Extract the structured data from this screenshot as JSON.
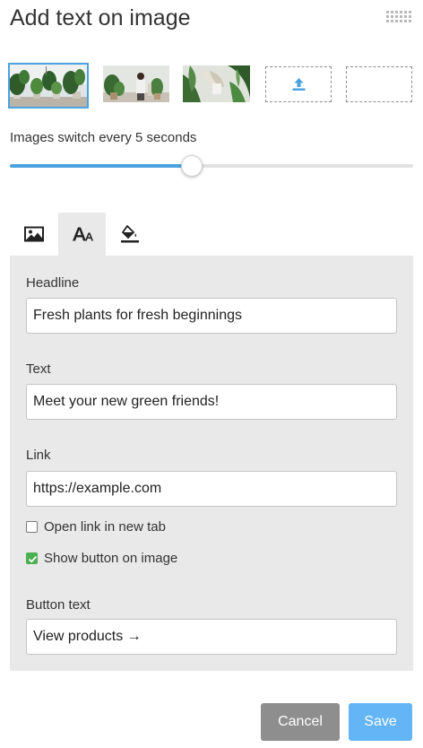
{
  "header": {
    "title": "Add text on image",
    "drag_icon": "drag-handle-icon"
  },
  "images": {
    "thumbnails": [
      {
        "name": "plants-shelf",
        "selected": true
      },
      {
        "name": "woman-with-plants",
        "selected": false
      },
      {
        "name": "tropical-leaves",
        "selected": false
      }
    ],
    "upload_icon": "upload-icon"
  },
  "slider": {
    "label": "Images switch every 5 seconds",
    "value_fraction": 0.45
  },
  "tabs": [
    {
      "icon": "image-icon",
      "active": false
    },
    {
      "icon": "text-size-icon",
      "active": true
    },
    {
      "icon": "fill-color-icon",
      "active": false
    }
  ],
  "form": {
    "headline_label": "Headline",
    "headline_value": "Fresh plants for fresh beginnings",
    "text_label": "Text",
    "text_value": "Meet your new green friends!",
    "link_label": "Link",
    "link_value": "https://example.com",
    "new_tab_label": "Open link in new tab",
    "new_tab_checked": false,
    "show_button_label": "Show button on image",
    "show_button_checked": true,
    "button_text_label": "Button text",
    "button_text_value": "View products →"
  },
  "actions": {
    "cancel_label": "Cancel",
    "save_label": "Save"
  },
  "colors": {
    "accent": "#4aa3df",
    "save": "#64b5f6",
    "cancel": "#8e8e8e",
    "panel": "#e9e9e9",
    "checkbox_checked": "#4caf50"
  }
}
